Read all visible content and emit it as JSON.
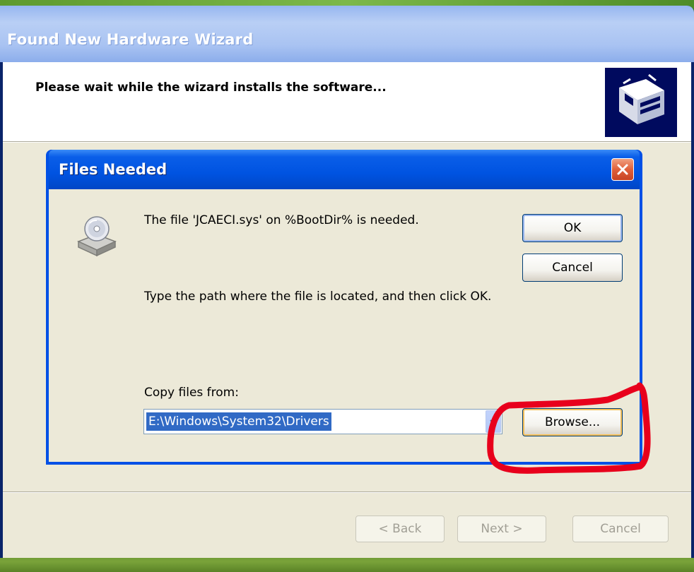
{
  "wizard": {
    "title": "Found New Hardware Wizard",
    "heading": "Please wait while the wizard installs the software...",
    "buttons": {
      "back": "< Back",
      "next": "Next >",
      "cancel": "Cancel"
    },
    "art_icon": "hardware-install-icon"
  },
  "dialog": {
    "title": "Files Needed",
    "message": "The file 'JCAECI.sys' on %BootDir% is needed.",
    "instruction": "Type the path where the file is located, and then click OK.",
    "copy_label": "Copy files from:",
    "copy_path": "E:\\Windows\\System32\\Drivers",
    "buttons": {
      "ok": "OK",
      "cancel": "Cancel",
      "browse": "Browse..."
    },
    "icon": "disk-drive-icon"
  },
  "colors": {
    "xp_blue": "#0053e1",
    "dialog_bg": "#ece9d8",
    "selection": "#316ac5",
    "annotation_red": "#e8001c",
    "desktop_green": "#5e9a2e"
  }
}
